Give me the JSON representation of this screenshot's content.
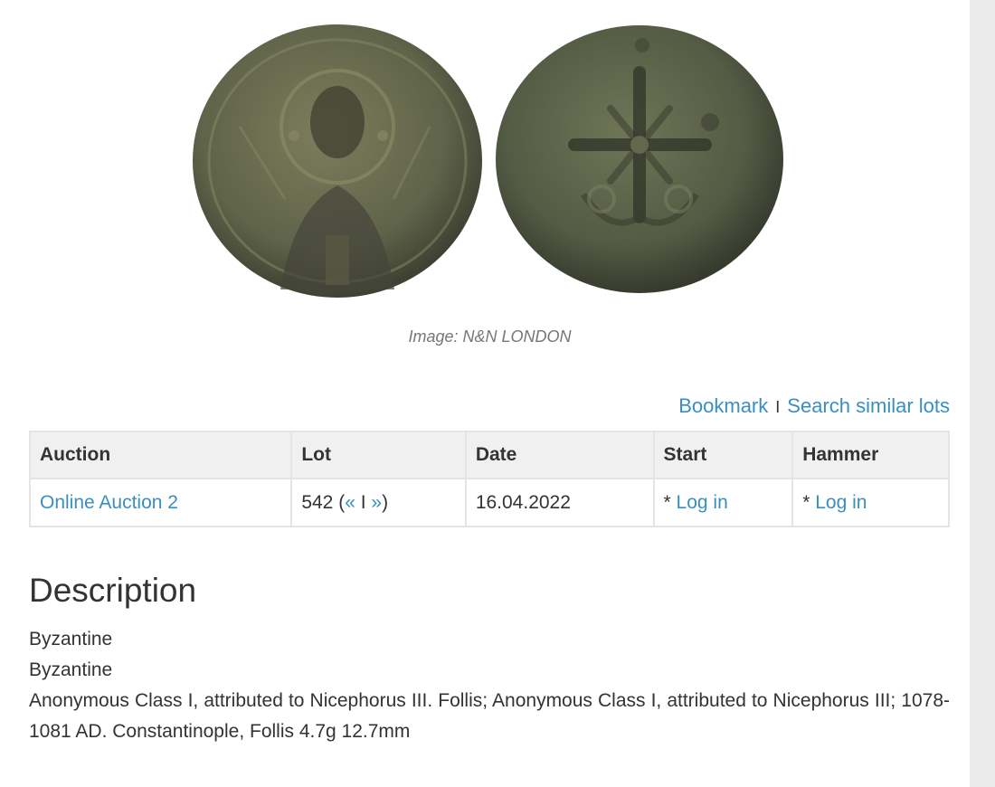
{
  "image": {
    "caption": "Image: N&N LONDON"
  },
  "actions": {
    "bookmark": "Bookmark",
    "separator": "I",
    "search_similar": "Search similar lots"
  },
  "table": {
    "headers": [
      "Auction",
      "Lot",
      "Date",
      "Start",
      "Hammer"
    ],
    "row": {
      "auction": "Online Auction 2",
      "lot_number": "542",
      "lot_open": " (",
      "prev": "«",
      "nav_sep": " I ",
      "next": "»",
      "lot_close": ")",
      "date": "16.04.2022",
      "start_prefix": "* ",
      "start_link": "Log in",
      "hammer_prefix": "* ",
      "hammer_link": "Log in"
    }
  },
  "description": {
    "title": "Description",
    "lines": [
      "Byzantine",
      "Byzantine",
      "Anonymous Class I, attributed to Nicephorus III. Follis; Anonymous Class I, attributed to Nicephorus III; 1078-1081 AD. Constantinople, Follis 4.7g 12.7mm"
    ]
  }
}
